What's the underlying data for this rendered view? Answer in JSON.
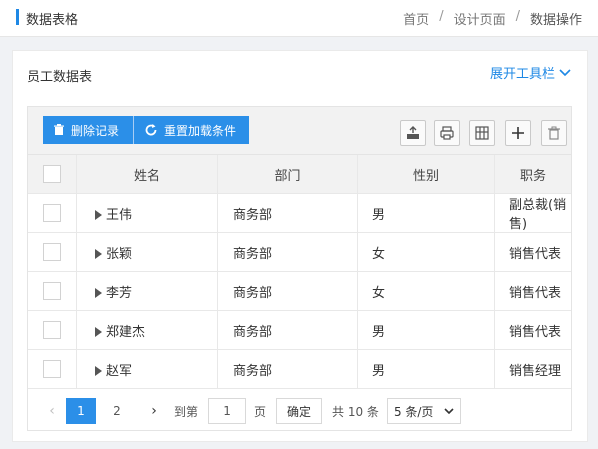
{
  "header": {
    "title": "数据表格",
    "breadcrumb": [
      "首页",
      "设计页面",
      "数据操作"
    ],
    "separator": "/"
  },
  "card": {
    "title": "员工数据表",
    "expand_label": "展开工具栏"
  },
  "toolbar": {
    "delete_label": "删除记录",
    "reload_label": "重置加载条件",
    "tools": [
      "export-icon",
      "print-icon",
      "columns-icon",
      "add-icon",
      "trash-icon"
    ]
  },
  "table": {
    "columns": [
      "姓名",
      "部门",
      "性别",
      "职务"
    ],
    "rows": [
      {
        "name": "王伟",
        "dept": "商务部",
        "gender": "男",
        "position": "副总裁(销售)"
      },
      {
        "name": "张颖",
        "dept": "商务部",
        "gender": "女",
        "position": "销售代表"
      },
      {
        "name": "李芳",
        "dept": "商务部",
        "gender": "女",
        "position": "销售代表"
      },
      {
        "name": "郑建杰",
        "dept": "商务部",
        "gender": "男",
        "position": "销售代表"
      },
      {
        "name": "赵军",
        "dept": "商务部",
        "gender": "男",
        "position": "销售经理"
      }
    ]
  },
  "pager": {
    "pages": [
      "1",
      "2"
    ],
    "current": "1",
    "goto_prefix": "到第",
    "goto_value": "1",
    "goto_suffix": "页",
    "confirm_label": "确定",
    "total_label": "共 10 条",
    "page_size": "5 条/页"
  },
  "colors": {
    "accent": "#2b8fe8",
    "link": "#1e88e5"
  }
}
